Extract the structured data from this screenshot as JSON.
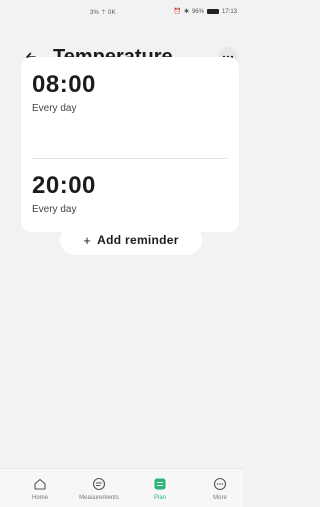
{
  "status_bar": {
    "left_text": "3% ⇡ 0K",
    "battery": "96%",
    "time": "17:13"
  },
  "header": {
    "title": "Temperature",
    "back_icon": "arrow-left-icon",
    "more_icon": "ellipsis-icon"
  },
  "reminders": [
    {
      "time": "08:00",
      "frequency": "Every day"
    },
    {
      "time": "20:00",
      "frequency": "Every day"
    }
  ],
  "add_reminder": {
    "plus": "+",
    "label": "Add reminder"
  },
  "tabs": [
    {
      "label": "Home",
      "icon": "home-icon",
      "active": false
    },
    {
      "label": "Measurements",
      "icon": "measurements-icon",
      "active": false
    },
    {
      "label": "Plan",
      "icon": "plan-icon",
      "active": true
    },
    {
      "label": "More",
      "icon": "more-icon",
      "active": false
    }
  ],
  "colors": {
    "accent": "#2bb673",
    "background": "#f2f2f4",
    "card": "#ffffff"
  }
}
